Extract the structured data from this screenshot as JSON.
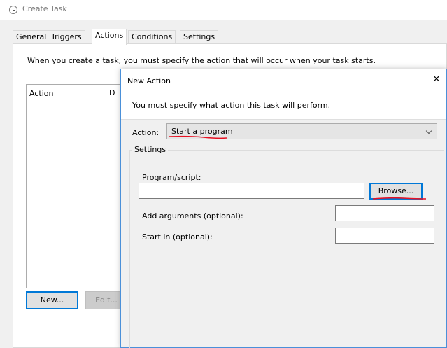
{
  "window": {
    "title": "Create Task",
    "icon": "clock-icon"
  },
  "tabs": [
    {
      "label": "General"
    },
    {
      "label": "Triggers"
    },
    {
      "label": "Actions",
      "active": true
    },
    {
      "label": "Conditions"
    },
    {
      "label": "Settings"
    }
  ],
  "actions_tab": {
    "description": "When you create a task, you must specify the action that will occur when your task starts.",
    "list_header_action": "Action",
    "list_header_details_partial": "D",
    "new_button": "New...",
    "edit_button": "Edit..."
  },
  "dialog": {
    "title": "New Action",
    "close_glyph": "✕",
    "banner_text": "You must specify what action this task will perform.",
    "action_label": "Action:",
    "action_value": "Start a program",
    "settings_legend": "Settings",
    "program_label": "Program/script:",
    "program_value": "",
    "browse_button": "Browse...",
    "arguments_label": "Add arguments (optional):",
    "arguments_value": "",
    "start_in_label": "Start in (optional):",
    "start_in_value": ""
  },
  "annotation_color": "#e81123",
  "accent_color": "#0078d7"
}
